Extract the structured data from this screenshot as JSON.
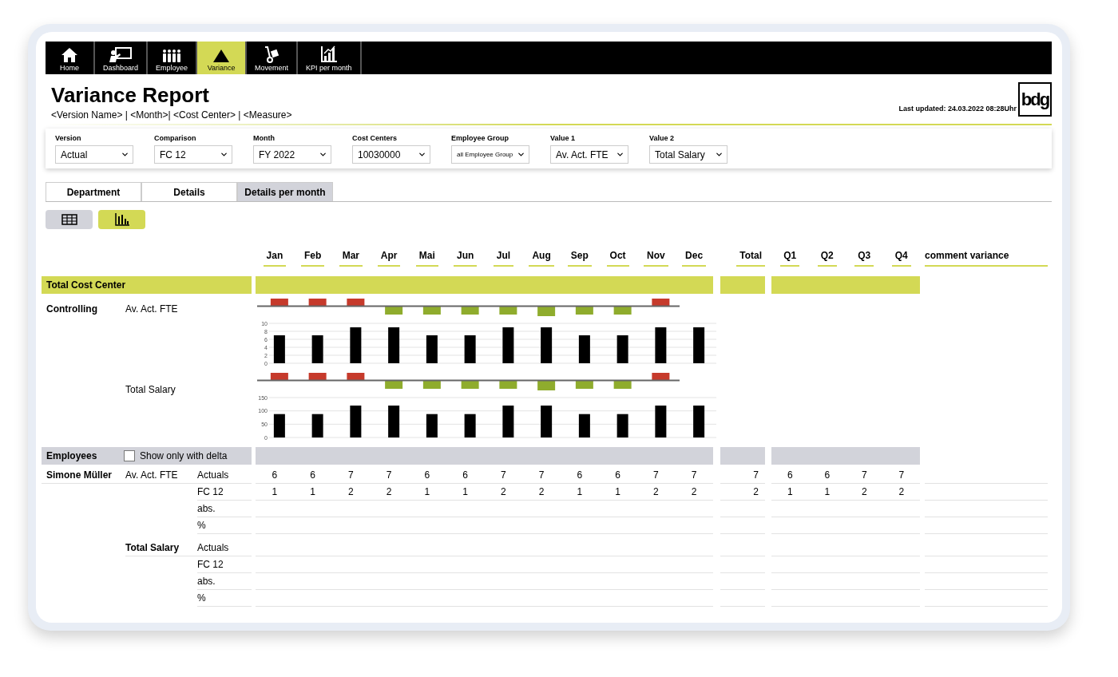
{
  "nav": [
    {
      "label": "Home",
      "selected": false
    },
    {
      "label": "Dashboard",
      "selected": false
    },
    {
      "label": "Employee",
      "selected": false
    },
    {
      "label": "Variance",
      "selected": true
    },
    {
      "label": "Movement",
      "selected": false
    },
    {
      "label": "KPI per month",
      "selected": false
    }
  ],
  "header": {
    "title": "Variance Report",
    "subtitle": "<Version Name> | <Month>| <Cost Center> | <Measure>",
    "last_updated": "Last updated: 24.03.2022  08:28Uhr",
    "logo": "bdg"
  },
  "filters": [
    {
      "label": "Version",
      "value": "Actual"
    },
    {
      "label": "Comparison",
      "value": "FC 12"
    },
    {
      "label": "Month",
      "value": "FY 2022"
    },
    {
      "label": "Cost Centers",
      "value": "10030000"
    },
    {
      "label": "Employee Group",
      "value": "all Employee Group"
    },
    {
      "label": "Value 1",
      "value": "Av. Act. FTE"
    },
    {
      "label": "Value 2",
      "value": "Total Salary"
    }
  ],
  "tabs": [
    {
      "label": "Department",
      "selected": false
    },
    {
      "label": "Details",
      "selected": false
    },
    {
      "label": "Details per month",
      "selected": true
    }
  ],
  "view_toggle": [
    {
      "selected": false
    },
    {
      "selected": true
    }
  ],
  "columns": {
    "months": [
      "Jan",
      "Feb",
      "Mar",
      "Apr",
      "Mai",
      "Jun",
      "Jul",
      "Aug",
      "Sep",
      "Oct",
      "Nov",
      "Dec"
    ],
    "total": "Total",
    "quarters": [
      "Q1",
      "Q2",
      "Q3",
      "Q4"
    ],
    "comment": "comment variance"
  },
  "total_cost_center": {
    "label": "Total Cost Center"
  },
  "department": {
    "name": "Controlling",
    "measures": [
      {
        "label": "Av. Act. FTE",
        "chart_data": {
          "type": "bar",
          "values": [
            7,
            7,
            9,
            9,
            7,
            7,
            9,
            9,
            7,
            7,
            9,
            9
          ],
          "ylim": [
            0,
            10
          ],
          "yticks": [
            0,
            2,
            4,
            6,
            8,
            10
          ],
          "grid": true
        }
      },
      {
        "label": "Total Salary",
        "chart_data": {
          "type": "bar",
          "values": [
            88,
            88,
            120,
            120,
            88,
            88,
            120,
            120,
            88,
            88,
            120,
            120
          ],
          "ylim": [
            0,
            150
          ],
          "yticks": [
            0,
            50,
            100,
            150
          ],
          "grid": true
        }
      }
    ]
  },
  "employees": {
    "label": "Employees",
    "filter": {
      "label": "Show only with delta",
      "checked": false
    }
  },
  "employee_rows": [
    {
      "name": "Simone Müller",
      "measures": [
        {
          "label": "Av. Act. FTE",
          "rows": [
            {
              "label": "Actuals",
              "months": [
                "6",
                "6",
                "7",
                "7",
                "6",
                "6",
                "7",
                "7",
                "6",
                "6",
                "7",
                "7"
              ],
              "total": "7",
              "quarters": [
                "6",
                "6",
                "7",
                "7"
              ]
            },
            {
              "label": "FC 12",
              "months": [
                "1",
                "1",
                "2",
                "2",
                "1",
                "1",
                "2",
                "2",
                "1",
                "1",
                "2",
                "2"
              ],
              "total": "2",
              "quarters": [
                "1",
                "1",
                "2",
                "2"
              ]
            },
            {
              "label": "abs."
            },
            {
              "label": "%"
            }
          ]
        },
        {
          "label": "Total Salary",
          "rows": [
            {
              "label": "Actuals"
            },
            {
              "label": "FC 12"
            },
            {
              "label": "abs."
            },
            {
              "label": "%"
            }
          ]
        }
      ]
    }
  ]
}
